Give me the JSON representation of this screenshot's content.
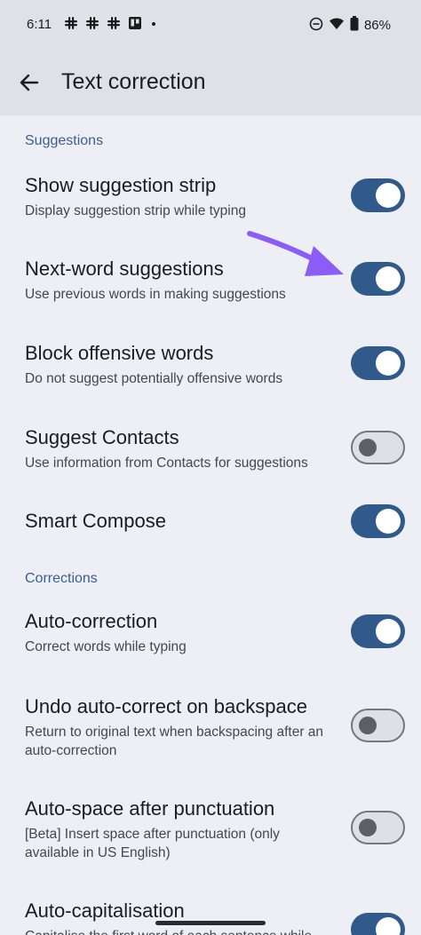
{
  "status": {
    "time": "6:11",
    "left_icons": [
      "slack-icon",
      "slack-icon",
      "slack-icon",
      "trello-icon",
      "dot-icon"
    ],
    "battery": "86%",
    "icons": [
      "dnd-icon",
      "wifi-icon",
      "battery-icon"
    ]
  },
  "app_bar": {
    "title": "Text correction"
  },
  "sections": {
    "suggestions": "Suggestions",
    "corrections": "Corrections"
  },
  "items": [
    {
      "title": "Show suggestion strip",
      "subtitle": "Display suggestion strip while typing",
      "on": true
    },
    {
      "title": "Next-word suggestions",
      "subtitle": "Use previous words in making suggestions",
      "on": true
    },
    {
      "title": "Block offensive words",
      "subtitle": "Do not suggest potentially offensive words",
      "on": true
    },
    {
      "title": "Suggest Contacts",
      "subtitle": "Use information from Contacts for suggestions",
      "on": false
    },
    {
      "title": "Smart Compose",
      "subtitle": "",
      "on": true
    },
    {
      "title": "Auto-correction",
      "subtitle": "Correct words while typing",
      "on": true
    },
    {
      "title": "Undo auto-correct on backspace",
      "subtitle": "Return to original text when backspacing after an auto-correction",
      "on": false
    },
    {
      "title": "Auto-space after punctuation",
      "subtitle": "[Beta] Insert space after punctuation (only available in US English)",
      "on": false
    },
    {
      "title": "Auto-capitalisation",
      "subtitle": "Capitalise the first word of each sentence while",
      "on": true
    }
  ],
  "colors": {
    "accent": "#2f5a89",
    "section_header": "#3a5f8f",
    "annotation_arrow": "#8b5cf6",
    "background": "#eeeff5"
  }
}
